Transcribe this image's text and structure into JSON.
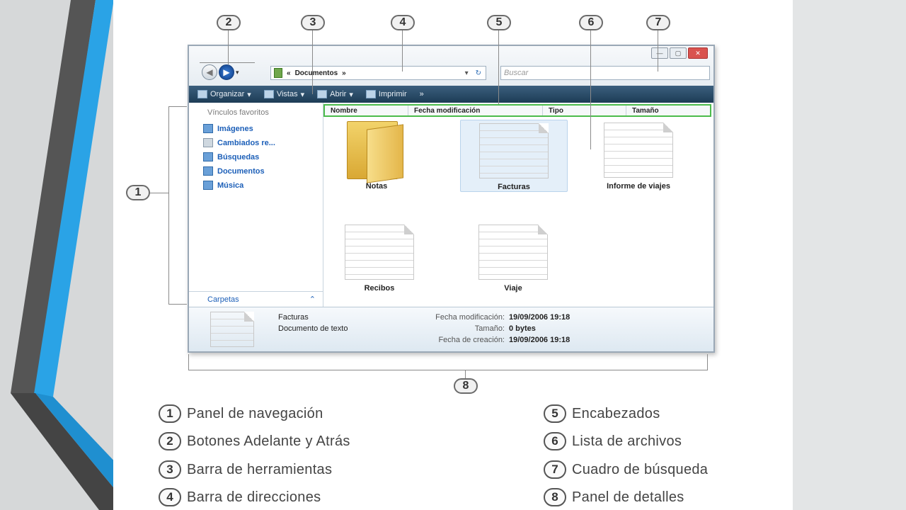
{
  "callouts": [
    "2",
    "3",
    "4",
    "5",
    "6",
    "7",
    "1",
    "8"
  ],
  "window": {
    "caption_buttons": [
      "—",
      "▢",
      "✕"
    ],
    "address": {
      "path": "Documentos",
      "sep": "»"
    },
    "search_placeholder": "Buscar",
    "toolbar": [
      {
        "label": "Organizar"
      },
      {
        "label": "Vistas"
      },
      {
        "label": "Abrir"
      },
      {
        "label": "Imprimir"
      }
    ],
    "nav": {
      "title": "Vínculos favoritos",
      "items": [
        "Imágenes",
        "Cambiados re...",
        "Búsquedas",
        "Documentos",
        "Música"
      ],
      "folders_label": "Carpetas"
    },
    "headers": [
      "Nombre",
      "Fecha modificación",
      "Tipo",
      "Tamaño"
    ],
    "files": [
      {
        "name": "Notas"
      },
      {
        "name": "Facturas"
      },
      {
        "name": "Informe de viajes"
      },
      {
        "name": "Recibos"
      },
      {
        "name": "Viaje"
      }
    ],
    "details": {
      "name": "Facturas",
      "type": "Documento de texto",
      "fields": [
        {
          "key": "Fecha modificación:",
          "value": "19/09/2006 19:18"
        },
        {
          "key": "Tamaño:",
          "value": "0 bytes"
        },
        {
          "key": "Fecha de creación:",
          "value": "19/09/2006 19:18"
        }
      ]
    }
  },
  "legend": [
    {
      "num": "1",
      "text": "Panel de navegación"
    },
    {
      "num": "2",
      "text": "Botones Adelante y Atrás"
    },
    {
      "num": "3",
      "text": "Barra de herramientas"
    },
    {
      "num": "4",
      "text": "Barra de direcciones"
    },
    {
      "num": "5",
      "text": "Encabezados"
    },
    {
      "num": "6",
      "text": "Lista de archivos"
    },
    {
      "num": "7",
      "text": "Cuadro de búsqueda"
    },
    {
      "num": "8",
      "text": "Panel de detalles"
    }
  ]
}
